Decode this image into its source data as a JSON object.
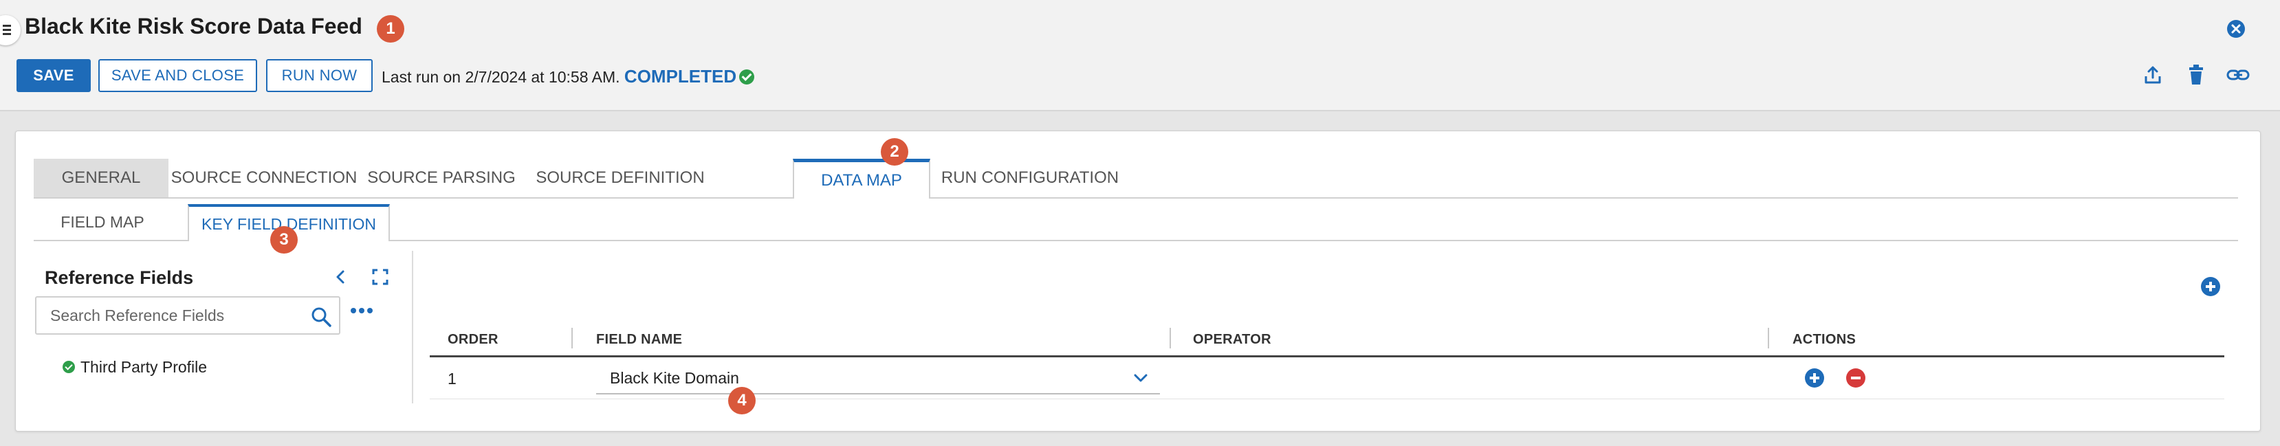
{
  "header": {
    "title": "Black Kite Risk Score Data Feed",
    "save_label": "SAVE",
    "save_close_label": "SAVE AND CLOSE",
    "run_now_label": "RUN NOW",
    "last_run_text": "Last run on 2/7/2024 at 10:58 AM.",
    "status": "COMPLETED"
  },
  "badges": [
    "1",
    "2",
    "3",
    "4"
  ],
  "tabs": [
    {
      "label": "GENERAL"
    },
    {
      "label": "SOURCE CONNECTION"
    },
    {
      "label": "SOURCE PARSING"
    },
    {
      "label": "SOURCE DEFINITION"
    },
    {
      "label": "DATA MAP"
    },
    {
      "label": "RUN CONFIGURATION"
    }
  ],
  "subtabs": [
    {
      "label": "FIELD MAP"
    },
    {
      "label": "KEY FIELD DEFINITION"
    }
  ],
  "reference_panel": {
    "title": "Reference Fields",
    "search_placeholder": "Search Reference Fields",
    "items": [
      {
        "label": "Third Party Profile"
      }
    ]
  },
  "grid": {
    "columns": [
      "ORDER",
      "FIELD NAME",
      "OPERATOR",
      "ACTIONS"
    ],
    "rows": [
      {
        "order": "1",
        "field_name": "Black Kite Domain",
        "operator": ""
      }
    ]
  },
  "icons": {
    "header": [
      "menu-icon",
      "close-icon",
      "export-icon",
      "delete-icon",
      "link-icon"
    ],
    "panel": [
      "chevron-left-icon",
      "expand-icon",
      "search-icon",
      "more-icon",
      "add-icon"
    ],
    "row": [
      "chevron-down-icon",
      "add-icon",
      "remove-icon"
    ]
  },
  "colors": {
    "accent": "#1e6bb8",
    "badge": "#d9583b",
    "success": "#2e9e4a",
    "danger": "#d63a3a"
  }
}
